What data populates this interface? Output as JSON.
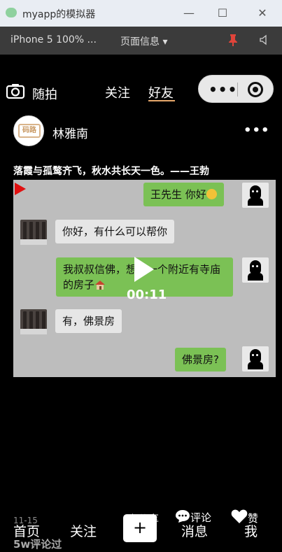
{
  "window": {
    "title": "myapp的模拟器",
    "min_icon": "minimize-icon",
    "max_icon": "maximize-icon",
    "close_icon": "close-icon"
  },
  "toolbar": {
    "device": "iPhone 5 100% ...",
    "page_info": "页面信息 ▾"
  },
  "header": {
    "camera_label": "随拍",
    "tabs": [
      {
        "label": "关注",
        "active": false
      },
      {
        "label": "好友",
        "active": true
      }
    ]
  },
  "post": {
    "author": "林雅南",
    "avatar_text": "码路",
    "more": "•••",
    "caption": "落霞与孤鹜齐飞，秋水共长天一色。——王勃",
    "video_duration": "00:11",
    "chat": [
      {
        "side": "right",
        "text": "王先生 你好"
      },
      {
        "side": "left",
        "text": "你好，有什么可以帮你"
      },
      {
        "side": "right",
        "text": "我叔叔信佛，想找一个附近有寺庙的房子"
      },
      {
        "side": "left",
        "text": "有，佛景房"
      },
      {
        "side": "right",
        "text": "佛景房?"
      }
    ],
    "date": "11-15",
    "share_label": "分享",
    "comment_label": "评论",
    "like_label": "赞",
    "comment_count": "5w评论过"
  },
  "tabbar": {
    "home": "首页",
    "follow": "关注",
    "add": "+",
    "messages": "消息",
    "me": "我"
  },
  "colors": {
    "accent_underline": "#e6a86b",
    "bubble_green": "#7bc155",
    "video_bg": "#bdbdbd"
  }
}
